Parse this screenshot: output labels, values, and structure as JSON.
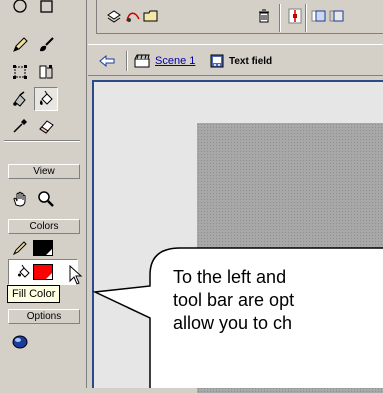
{
  "tools_panel": {
    "sections": [
      {
        "label": "View"
      },
      {
        "label": "Colors"
      },
      {
        "label": "Options"
      }
    ],
    "tools": [
      "oval-tool",
      "rectangle-tool",
      "pencil-tool",
      "brush-tool",
      "free-transform-tool",
      "fill-transform-tool",
      "ink-bottle-tool",
      "paint-bucket-tool",
      "eyedropper-tool",
      "eraser-tool",
      "hand-tool",
      "zoom-tool"
    ],
    "stroke_color": "#000000",
    "fill_color": "#ff0000",
    "tooltip": "Fill Color"
  },
  "edit_bar": {
    "scene_label": "Scene 1",
    "symbol_label": "Text field"
  },
  "callout": {
    "text": "To the left and\ntool bar are opt\nallow you to ch"
  },
  "colors": {
    "panel_bg": "#d4d0c8",
    "stage_border": "#2a4a8a",
    "link": "#0000aa"
  }
}
